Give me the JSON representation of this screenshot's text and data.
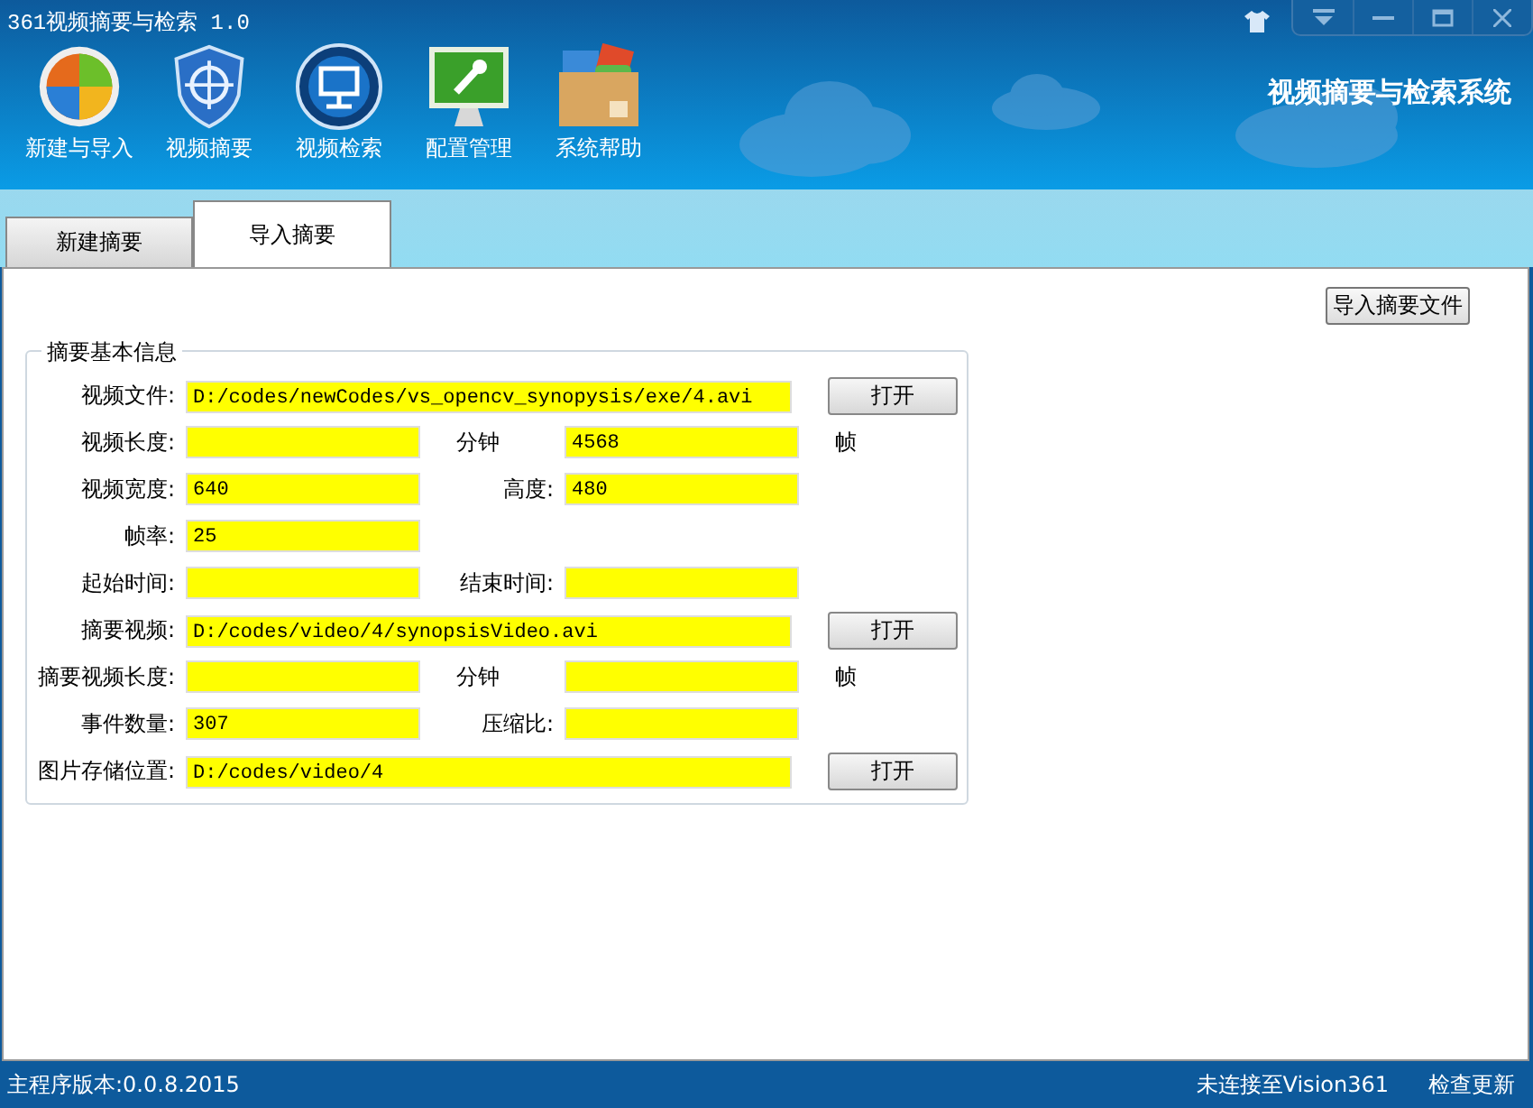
{
  "window": {
    "title": "361视频摘要与检索 1.0"
  },
  "toolbar": [
    {
      "label": "新建与导入"
    },
    {
      "label": "视频摘要"
    },
    {
      "label": "视频检索"
    },
    {
      "label": "配置管理"
    },
    {
      "label": "系统帮助"
    }
  ],
  "brand": "视频摘要与检索系统",
  "tabs": [
    {
      "label": "新建摘要",
      "selected": false
    },
    {
      "label": "导入摘要",
      "selected": true
    }
  ],
  "import_button": "导入摘要文件",
  "group": {
    "title": "摘要基本信息",
    "rows": [
      {
        "kind": "wide",
        "label": "视频文件:",
        "value": "D:/codes/newCodes/vs_opencv_synopysis/exe/4.avi",
        "button": "打开"
      },
      {
        "kind": "pair",
        "fields": [
          {
            "label": "视频长度:",
            "unit": "分钟"
          },
          {
            "value": "4568",
            "unit": "帧"
          }
        ]
      },
      {
        "kind": "pair",
        "fields": [
          {
            "label": "视频宽度:",
            "value": "640"
          },
          {
            "label": "高度:",
            "value": "480"
          }
        ]
      },
      {
        "kind": "pair",
        "fields": [
          {
            "label": "帧率:",
            "value": "25"
          }
        ]
      },
      {
        "kind": "pair",
        "fields": [
          {
            "label": "起始时间:"
          },
          {
            "label": "结束时间:"
          }
        ]
      },
      {
        "kind": "wide",
        "label": "摘要视频:",
        "value": "D:/codes/video/4/synopsisVideo.avi",
        "button": "打开"
      },
      {
        "kind": "pair",
        "fields": [
          {
            "label": "摘要视频长度:",
            "unit": "分钟"
          },
          {
            "unit": "帧"
          }
        ]
      },
      {
        "kind": "pair",
        "fields": [
          {
            "label": "事件数量:",
            "value": "307"
          },
          {
            "label": "压缩比:"
          }
        ]
      },
      {
        "kind": "wide",
        "label": "图片存储位置:",
        "value": "D:/codes/video/4",
        "button": "打开"
      }
    ]
  },
  "status_bar": {
    "version": "主程序版本:0.0.8.2015",
    "connection": "未连接至Vision361",
    "update": "检查更新"
  }
}
